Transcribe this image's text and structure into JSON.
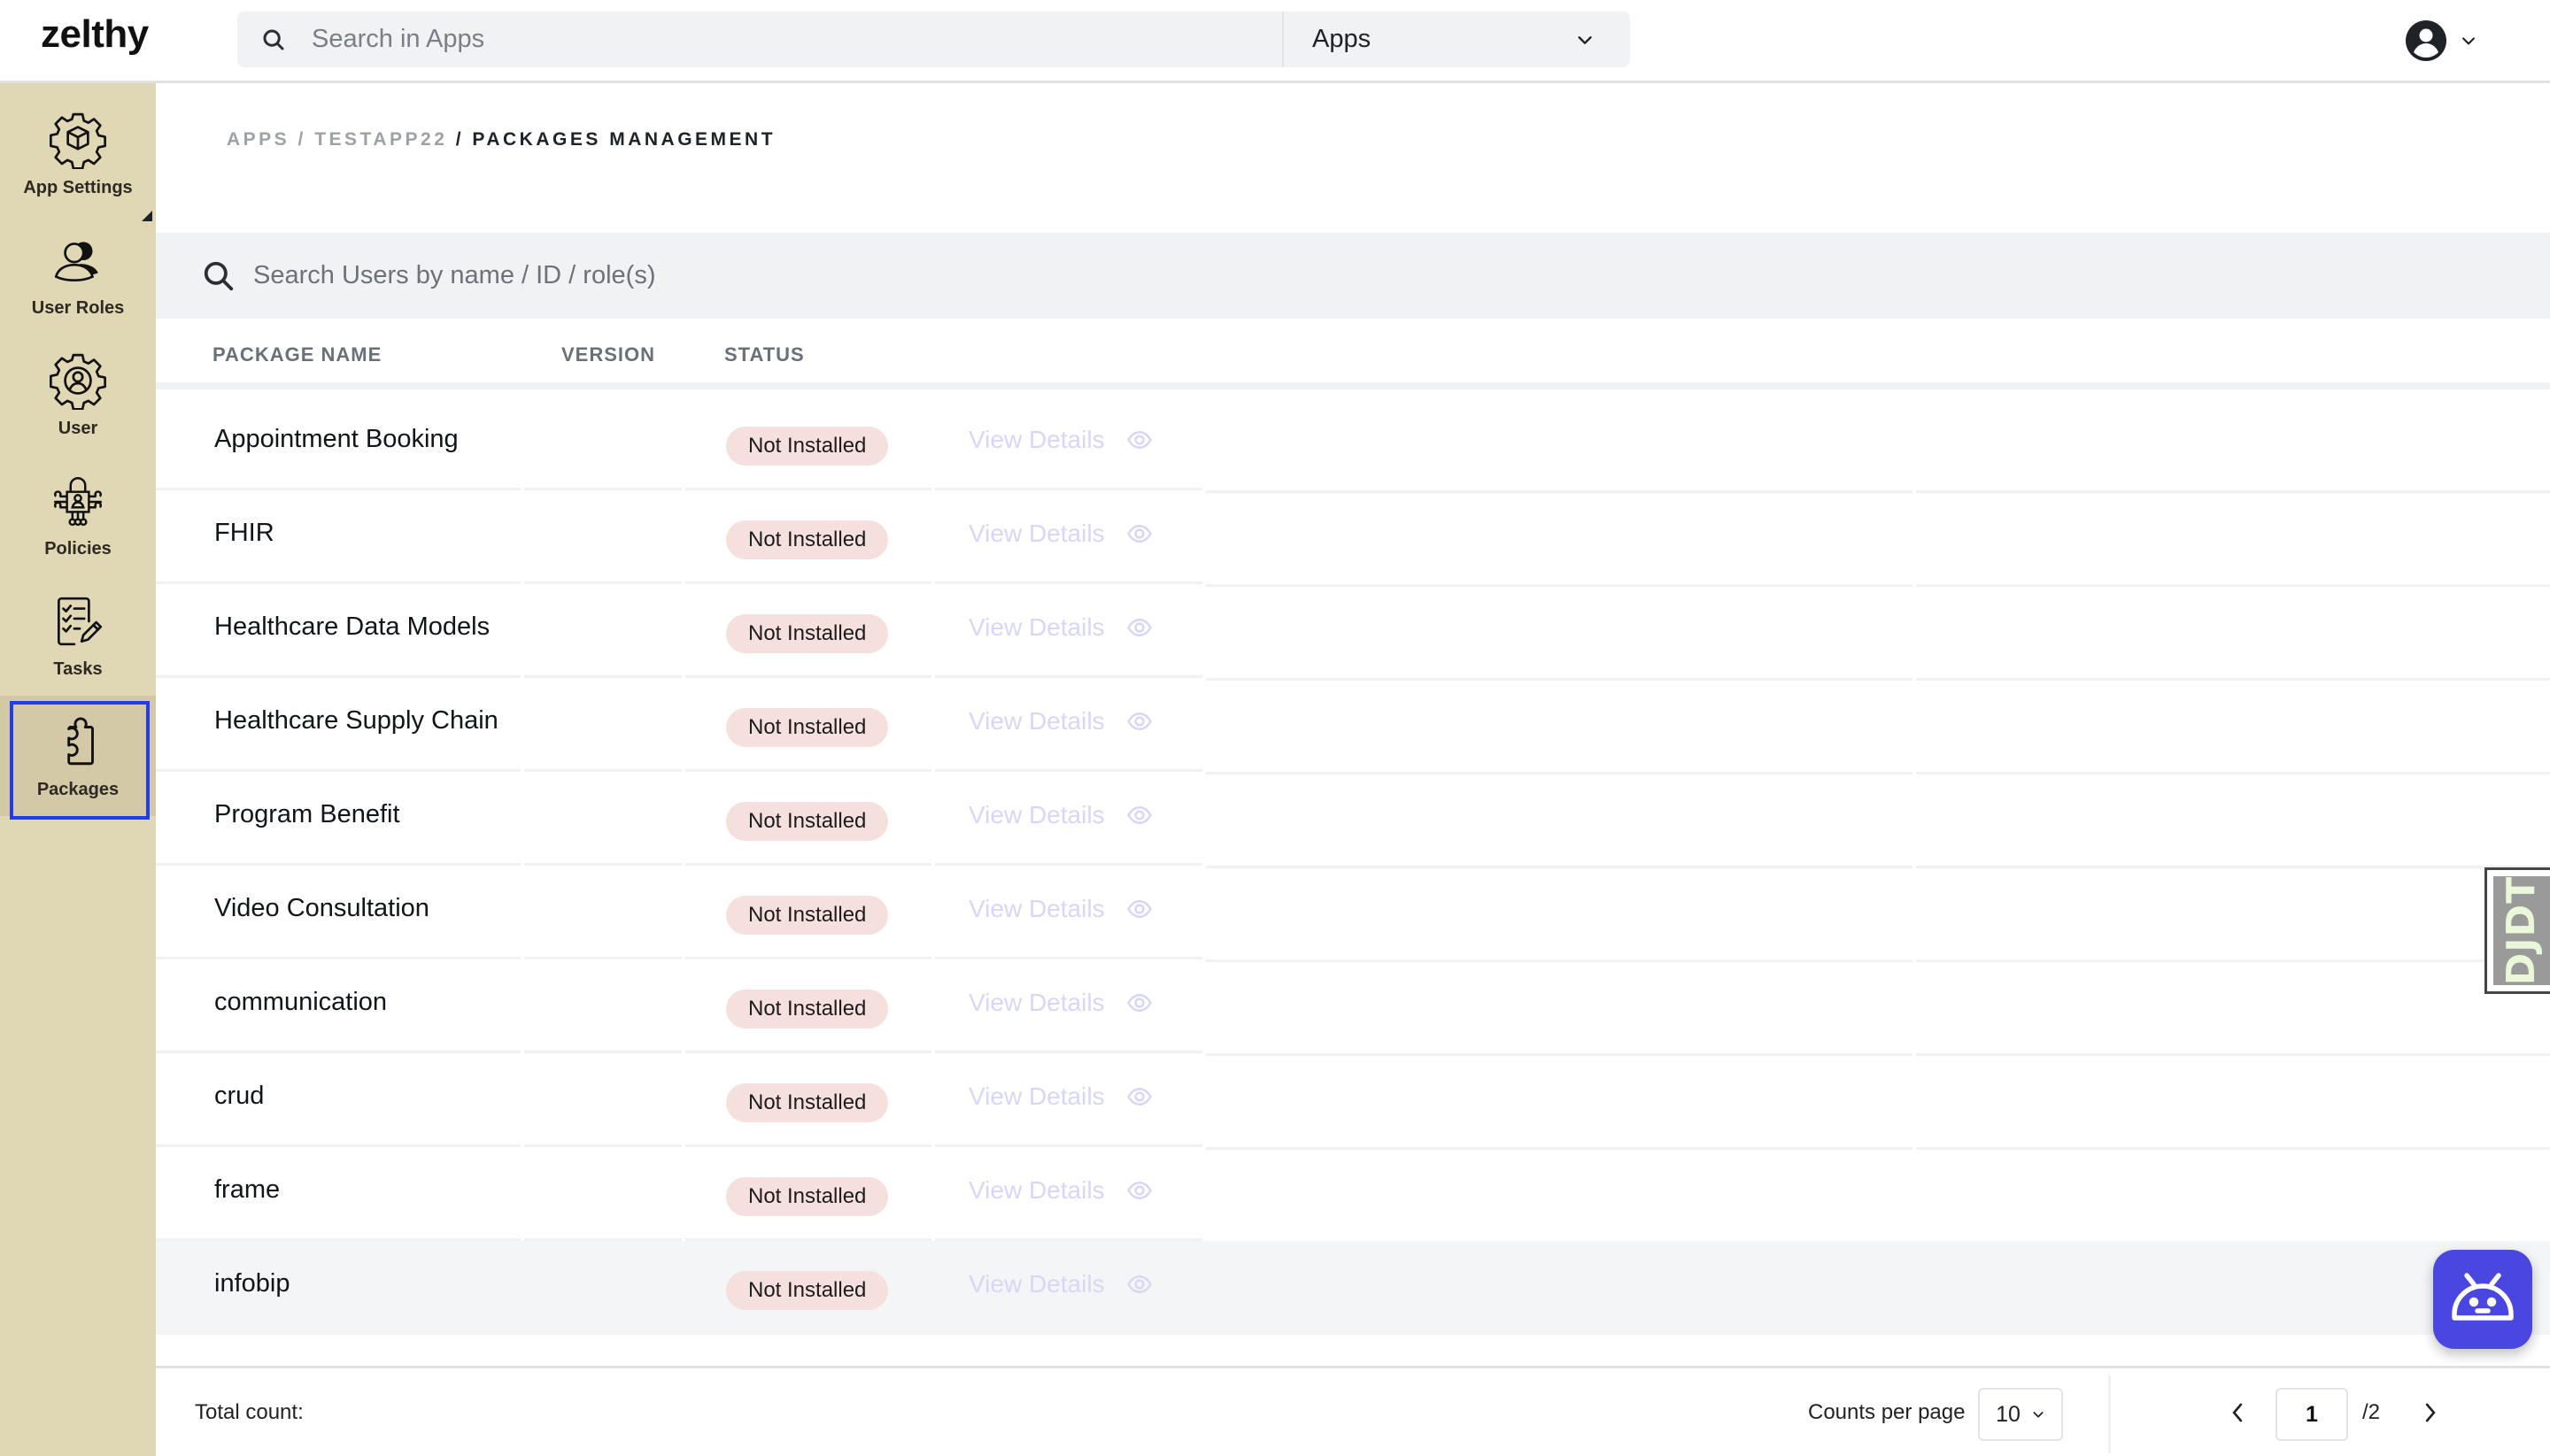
{
  "topbar": {
    "logo": "zelthy",
    "search_placeholder": "Search in Apps",
    "apps_select_value": "Apps",
    "icons": {
      "search": "search-icon",
      "chevron": "chevron-down-icon",
      "user": "user-avatar-icon"
    }
  },
  "sidebar": {
    "items": [
      {
        "label": "App Settings",
        "icon": "gear-cube-icon",
        "active": false
      },
      {
        "label": "User Roles",
        "icon": "user-roles-icon",
        "active": false
      },
      {
        "label": "User",
        "icon": "user-gear-icon",
        "active": false
      },
      {
        "label": "Policies",
        "icon": "policy-lock-icon",
        "active": false
      },
      {
        "label": "Tasks",
        "icon": "checklist-icon",
        "active": false
      },
      {
        "label": "Packages",
        "icon": "puzzle-icon",
        "active": true
      }
    ]
  },
  "breadcrumb": {
    "items": [
      "APPS",
      "TESTAPP22",
      "PACKAGES MANAGEMENT"
    ],
    "separator": "/"
  },
  "table": {
    "search_placeholder": "Search Users by name / ID / role(s)",
    "columns": [
      "PACKAGE NAME",
      "VERSION",
      "STATUS"
    ],
    "action_label": "View Details",
    "rows": [
      {
        "name": "Appointment Booking",
        "version": "",
        "status": "Not Installed"
      },
      {
        "name": "FHIR",
        "version": "",
        "status": "Not Installed"
      },
      {
        "name": "Healthcare Data Models",
        "version": "",
        "status": "Not Installed"
      },
      {
        "name": "Healthcare Supply Chain",
        "version": "",
        "status": "Not Installed"
      },
      {
        "name": "Program Benefit",
        "version": "",
        "status": "Not Installed"
      },
      {
        "name": "Video Consultation",
        "version": "",
        "status": "Not Installed"
      },
      {
        "name": "communication",
        "version": "",
        "status": "Not Installed"
      },
      {
        "name": "crud",
        "version": "",
        "status": "Not Installed"
      },
      {
        "name": "frame",
        "version": "",
        "status": "Not Installed"
      },
      {
        "name": "infobip",
        "version": "",
        "status": "Not Installed"
      }
    ]
  },
  "footer": {
    "total_label": "Total count:",
    "counts_per_page_label": "Counts per page",
    "counts_per_page_value": "10",
    "current_page": "1",
    "total_pages": "/2"
  },
  "floating": {
    "djdt_label": "DJDT",
    "bot_icon": "robot-icon"
  },
  "colors": {
    "sidebar_bg": "#e0d8b4",
    "active_outline": "#1f3cf0",
    "badge_bg": "#f6e0dd",
    "view_details": "#d8d6f7",
    "bot_bg": "#4a46e0"
  }
}
